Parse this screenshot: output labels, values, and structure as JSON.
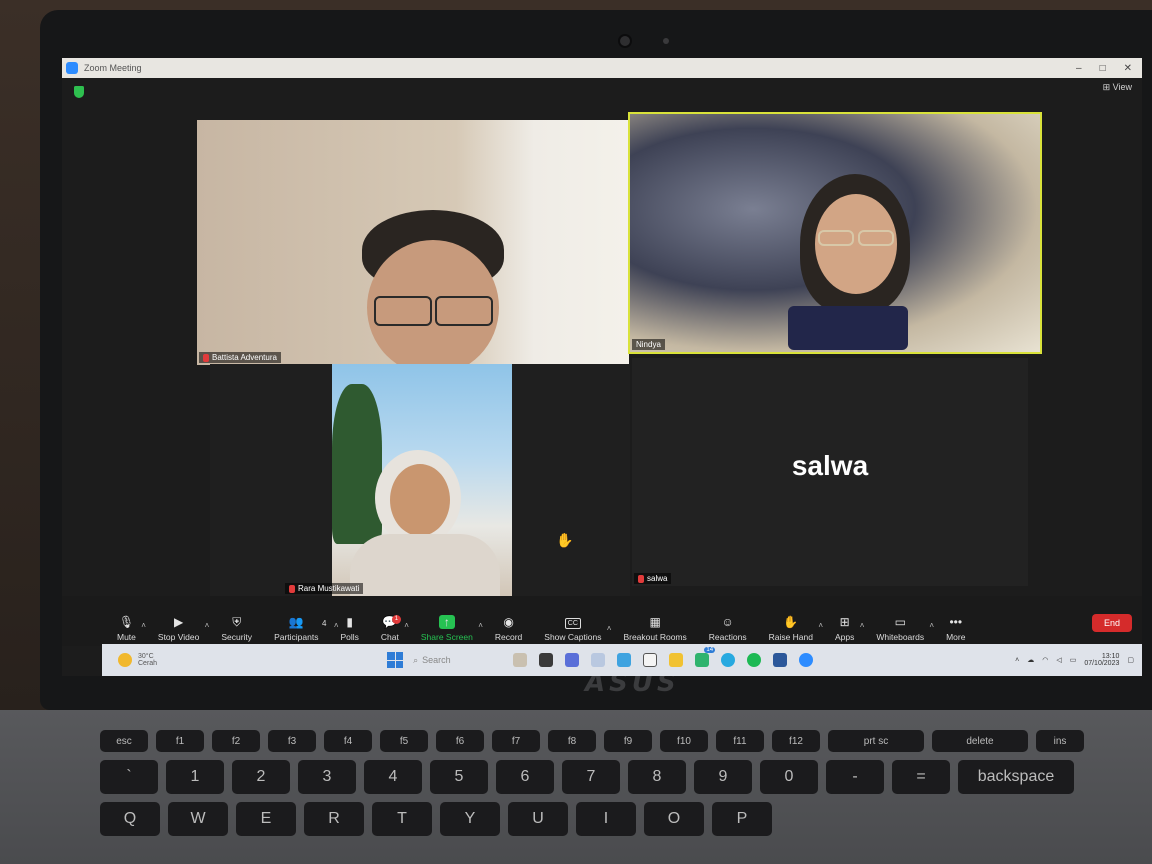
{
  "window": {
    "title": "Zoom Meeting",
    "view_label": "View",
    "controls": [
      "–",
      "□",
      "✕"
    ]
  },
  "participants": [
    {
      "name": "Battista Adventura",
      "muted": true
    },
    {
      "name": "Nindya",
      "muted": false,
      "active_speaker": true
    },
    {
      "name": "Rara Mustikawati",
      "muted": true
    },
    {
      "name": "salwa",
      "muted": true,
      "video_off": true,
      "display_name": "salwa"
    }
  ],
  "toolbar": {
    "mute": "Mute",
    "stop_video": "Stop Video",
    "security": "Security",
    "participants": "Participants",
    "participants_count": "4",
    "polls": "Polls",
    "chat": "Chat",
    "chat_badge": "1",
    "share_screen": "Share Screen",
    "record": "Record",
    "show_captions": "Show Captions",
    "captions_icon": "CC",
    "breakout_rooms": "Breakout Rooms",
    "reactions": "Reactions",
    "raise_hand": "Raise Hand",
    "apps": "Apps",
    "whiteboards": "Whiteboards",
    "more": "More",
    "end": "End"
  },
  "taskbar": {
    "weather_temp": "30°C",
    "weather_desc": "Cerah",
    "search_placeholder": "Search",
    "store_badge": "14",
    "clock_time": "13:10",
    "clock_date": "07/10/2023"
  },
  "device": {
    "brand": "ASUS"
  },
  "keyboard": {
    "fn_row": [
      "esc",
      "f1",
      "f2",
      "f3",
      "f4",
      "f5",
      "f6",
      "f7",
      "f8",
      "f9",
      "f10",
      "f11",
      "f12",
      "prt sc",
      "delete",
      "ins"
    ],
    "num_row": [
      "`",
      "1",
      "2",
      "3",
      "4",
      "5",
      "6",
      "7",
      "8",
      "9",
      "0",
      "-",
      "=",
      "backspace"
    ],
    "top_row": [
      "Q",
      "W",
      "E",
      "R",
      "T",
      "Y",
      "U",
      "I",
      "O",
      "P"
    ]
  }
}
